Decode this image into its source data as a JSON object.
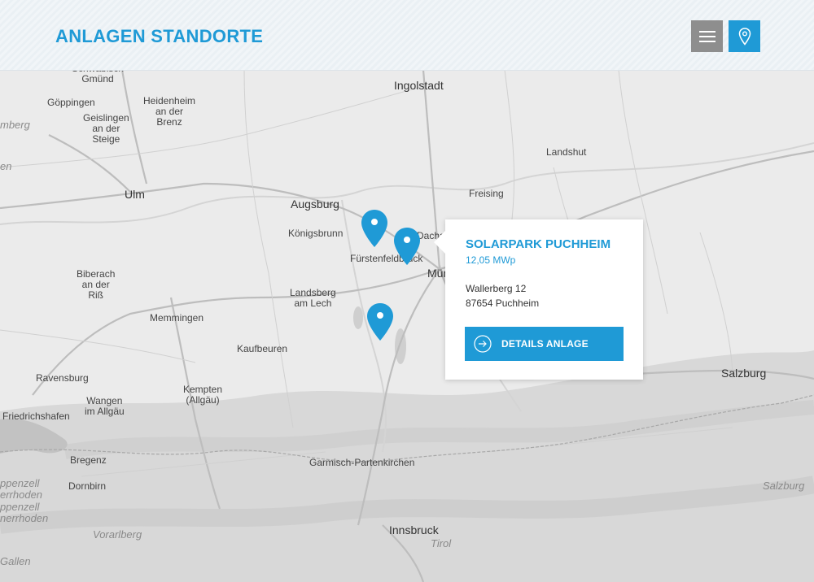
{
  "header": {
    "title": "ANLAGEN STANDORTE",
    "menu_icon": "hamburger-menu-icon",
    "location_icon": "map-pin-icon"
  },
  "colors": {
    "accent": "#1f9ad6",
    "menu_button": "#8e8e8e"
  },
  "map": {
    "places": {
      "schwabisch_gmund": "Schwäbisch\nGmünd",
      "goppingen": "Göppingen",
      "heidenheim": "Heidenheim\nan der\nBrenz",
      "geislingen": "Geislingen\nan der\nSteige",
      "ingolstadt": "Ingolstadt",
      "landshut": "Landshut",
      "ulm": "Ulm",
      "augsburg": "Augsburg",
      "freising": "Freising",
      "konigsbrunn": "Königsbrunn",
      "furstenfeldbruck": "Fürstenfeldbruck",
      "dachau": "Dachau",
      "munchen": "München",
      "biberach": "Biberach\nan der\nRiß",
      "landsberg": "Landsberg\nam Lech",
      "memmingen": "Memmingen",
      "kaufbeuren": "Kaufbeuren",
      "ravensburg": "Ravensburg",
      "kempten": "Kempten\n(Allgäu)",
      "wangen": "Wangen\nim Allgäu",
      "friedrichshafen": "Friedrichshafen",
      "salzburg": "Salzburg",
      "bregenz": "Bregenz",
      "dornbirn": "Dornbirn",
      "garmisch": "Garmisch-Partenkirchen",
      "innsbruck": "Innsbruck",
      "tirol": "Tirol",
      "vorarlberg": "Vorarlberg",
      "salzburg_region": "Salzburg",
      "appenzell": "ppenzell\nerrhoden\nppenzell\nnerrhoden",
      "gallen": "Gallen",
      "wurttemberg_edge": "mberg",
      "left_edge": "en"
    }
  },
  "popup": {
    "title": "SOLARPARK PUCHHEIM",
    "capacity": "12,05 MWp",
    "street": "Wallerberg 12",
    "city": "87654 Puchheim",
    "button_label": "DETAILS ANLAGE",
    "button_icon": "arrow-right-circle-icon"
  },
  "markers": [
    "map-marker",
    "map-marker",
    "map-marker"
  ]
}
